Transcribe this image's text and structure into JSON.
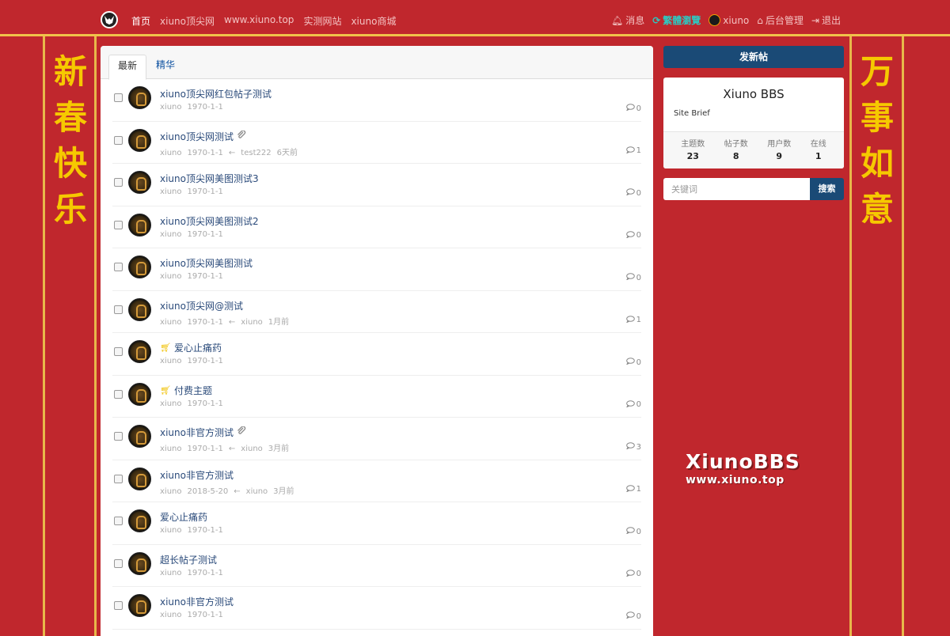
{
  "nav": {
    "left_items": [
      "首页",
      "xiuno顶尖网",
      "www.xiuno.top",
      "实测网站",
      "xiuno商城"
    ],
    "messages": "消息",
    "traditional": "繁體瀏覽",
    "user": "xiuno",
    "admin": "后台管理",
    "logout": "退出"
  },
  "couplet": {
    "left": [
      "新",
      "春",
      "快",
      "乐"
    ],
    "right": [
      "万",
      "事",
      "如",
      "意"
    ]
  },
  "tabs": [
    "最新",
    "精华"
  ],
  "threads": [
    {
      "subject": "xiuno顶尖网红包帖子测试",
      "icon": "",
      "meta": [
        "xiuno",
        "1970-1-1"
      ],
      "replies": "0"
    },
    {
      "subject": "xiuno顶尖网测试",
      "icon": "attachment-icon",
      "meta": [
        "xiuno",
        "1970-1-1",
        "←",
        "test222",
        "6天前"
      ],
      "replies": "1"
    },
    {
      "subject": "xiuno顶尖网美图测试3",
      "icon": "",
      "meta": [
        "xiuno",
        "1970-1-1"
      ],
      "replies": "0"
    },
    {
      "subject": "xiuno顶尖网美图测试2",
      "icon": "",
      "meta": [
        "xiuno",
        "1970-1-1"
      ],
      "replies": "0"
    },
    {
      "subject": "xiuno顶尖网美图测试",
      "icon": "",
      "meta": [
        "xiuno",
        "1970-1-1"
      ],
      "replies": "0"
    },
    {
      "subject": "xiuno顶尖网@测试",
      "icon": "",
      "meta": [
        "xiuno",
        "1970-1-1",
        "←",
        "xiuno",
        "1月前"
      ],
      "replies": "1"
    },
    {
      "subject": "爱心止痛药",
      "icon": "cart-icon",
      "meta": [
        "xiuno",
        "1970-1-1"
      ],
      "replies": "0"
    },
    {
      "subject": "付费主题",
      "icon": "cart-icon",
      "meta": [
        "xiuno",
        "1970-1-1"
      ],
      "replies": "0"
    },
    {
      "subject": "xiuno非官方测试",
      "icon": "attachment-icon",
      "meta": [
        "xiuno",
        "1970-1-1",
        "←",
        "xiuno",
        "3月前"
      ],
      "replies": "3"
    },
    {
      "subject": "xiuno非官方测试",
      "icon": "",
      "meta": [
        "xiuno",
        "2018-5-20",
        "←",
        "xiuno",
        "3月前"
      ],
      "replies": "1"
    },
    {
      "subject": "爱心止痛药",
      "icon": "",
      "meta": [
        "xiuno",
        "1970-1-1"
      ],
      "replies": "0"
    },
    {
      "subject": "超长帖子测试",
      "icon": "",
      "meta": [
        "xiuno",
        "1970-1-1"
      ],
      "replies": "0"
    },
    {
      "subject": "xiuno非官方测试",
      "icon": "",
      "meta": [
        "xiuno",
        "1970-1-1"
      ],
      "replies": "0"
    }
  ],
  "sidebar": {
    "post_button": "发新帖",
    "site_title": "Xiuno BBS",
    "site_brief": "Site Brief",
    "stats": [
      {
        "label": "主题数",
        "value": "23"
      },
      {
        "label": "帖子数",
        "value": "8"
      },
      {
        "label": "用户数",
        "value": "9"
      },
      {
        "label": "在线",
        "value": "1"
      }
    ],
    "search_placeholder": "关键词",
    "search_button": "搜索"
  },
  "watermark": {
    "line1": "XiunoBBS",
    "line2": "www.xiuno.top"
  },
  "colors": {
    "background": "#c0272d",
    "gold": "#e8b84a",
    "primary": "#1a4a76",
    "couplet_text": "#f6c900"
  }
}
